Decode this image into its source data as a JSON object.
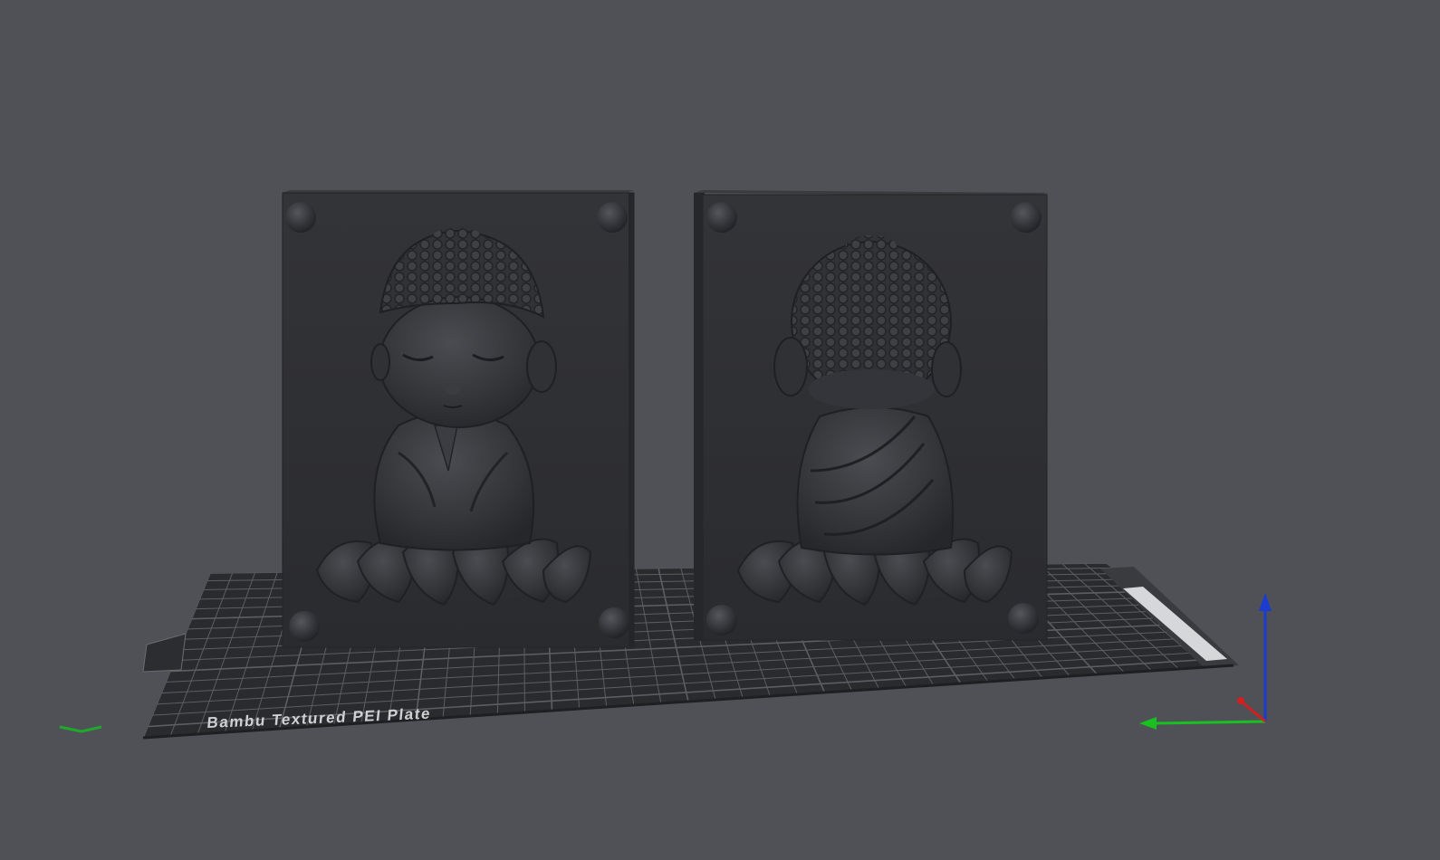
{
  "viewport": {
    "background": "#4f5157"
  },
  "build_plate": {
    "label": "Bambu Textured PEI Plate",
    "color": "#2a2b2e",
    "grid_color": "#5c5e64"
  },
  "models": [
    {
      "name": "buddha-mold-front-half",
      "view": "front",
      "color": "#2f3033"
    },
    {
      "name": "buddha-mold-back-half",
      "view": "back",
      "color": "#2f3033"
    }
  ],
  "axes": {
    "x_color": "#d02020",
    "y_color": "#18c020",
    "z_color": "#1a3ccf"
  }
}
